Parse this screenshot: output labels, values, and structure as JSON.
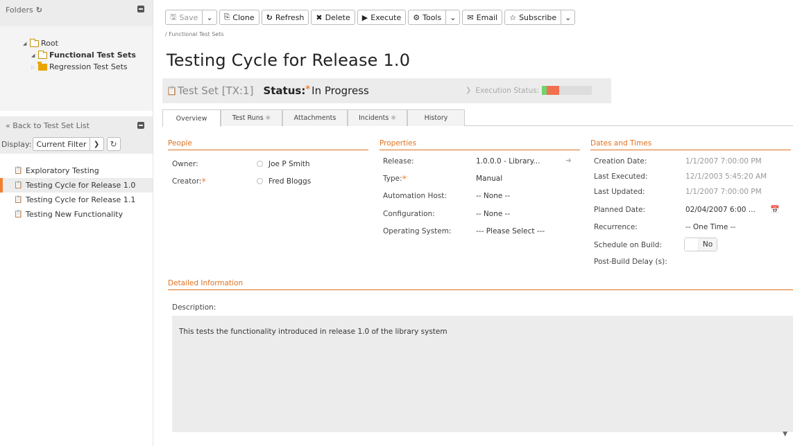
{
  "sidebar": {
    "folders_label": "Folders",
    "tree": {
      "root": "Root",
      "functional": "Functional Test Sets",
      "regression": "Regression Test Sets"
    },
    "back_label": "« Back to Test Set List",
    "display_label": "Display:",
    "filter_value": "Current Filter",
    "items": [
      {
        "label": "Exploratory Testing"
      },
      {
        "label": "Testing Cycle for Release 1.0"
      },
      {
        "label": "Testing Cycle for Release 1.1"
      },
      {
        "label": "Testing New Functionality"
      }
    ]
  },
  "toolbar": {
    "save": "Save",
    "clone": "Clone",
    "refresh": "Refresh",
    "delete": "Delete",
    "execute": "Execute",
    "tools": "Tools",
    "email": "Email",
    "subscribe": "Subscribe"
  },
  "breadcrumb": "/ Functional Test Sets",
  "page_title": "Testing Cycle for Release 1.0",
  "status_bar": {
    "id_label": "Test Set [TX:1]",
    "status_label": "Status:",
    "required_mark": "*",
    "status_value": "In Progress",
    "execution_label": "Execution Status:",
    "execution_pass_fraction": 0.1,
    "execution_fail_fraction": 0.25
  },
  "tabs": [
    {
      "label": "Overview"
    },
    {
      "label": "Test Runs"
    },
    {
      "label": "Attachments"
    },
    {
      "label": "Incidents"
    },
    {
      "label": "History"
    }
  ],
  "people": {
    "header": "People",
    "owner_label": "Owner:",
    "owner_value": "Joe P Smith",
    "creator_label": "Creator:",
    "creator_value": "Fred Bloggs"
  },
  "properties": {
    "header": "Properties",
    "release_label": "Release:",
    "release_value": "1.0.0.0 - Library...",
    "type_label": "Type:",
    "type_value": "Manual",
    "automation_label": "Automation Host:",
    "automation_value": "-- None --",
    "configuration_label": "Configuration:",
    "configuration_value": "-- None --",
    "os_label": "Operating System:",
    "os_value": "--- Please Select ---"
  },
  "dates": {
    "header": "Dates and Times",
    "creation_label": "Creation Date:",
    "creation_value": "1/1/2007 7:00:00 PM",
    "executed_label": "Last Executed:",
    "executed_value": "12/1/2003 5:45:20 AM",
    "updated_label": "Last Updated:",
    "updated_value": "1/1/2007 7:00:00 PM",
    "planned_label": "Planned Date:",
    "planned_value": "02/04/2007 6:00 ...",
    "recurrence_label": "Recurrence:",
    "recurrence_value": "-- One Time --",
    "schedule_label": "Schedule on Build:",
    "schedule_value": "No",
    "delay_label": "Post-Build Delay (s):"
  },
  "detailed": {
    "header": "Detailed Information",
    "description_label": "Description:",
    "description_value": "This tests the functionality introduced in release 1.0 of the library system"
  },
  "colors": {
    "accent": "#e07020",
    "pass": "#6fd36f",
    "fail": "#f07050"
  }
}
